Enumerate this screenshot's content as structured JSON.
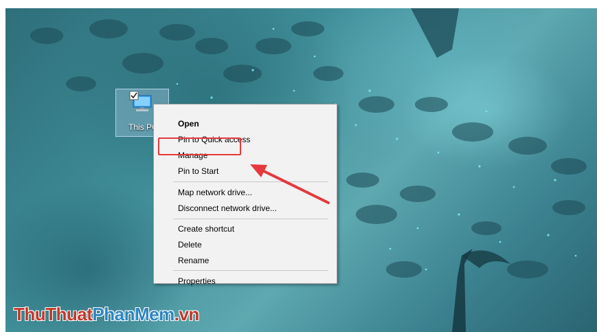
{
  "desktop": {
    "icon": {
      "label": "This PC",
      "icon_name": "this-pc-icon"
    }
  },
  "context_menu": {
    "items": [
      {
        "label": "Open",
        "bold": true
      },
      {
        "label": "Pin to Quick access"
      },
      {
        "label": "Manage",
        "highlighted": true
      },
      {
        "label": "Pin to Start"
      },
      {
        "label": "Map network drive..."
      },
      {
        "label": "Disconnect network drive..."
      },
      {
        "label": "Create shortcut"
      },
      {
        "label": "Delete"
      },
      {
        "label": "Rename"
      },
      {
        "label": "Properties"
      }
    ]
  },
  "annotation": {
    "highlight_color": "#e5393b",
    "arrow_color": "#e5393b"
  },
  "watermark": {
    "part1": "ThuThuat",
    "part2": "PhanMem",
    "part3": ".vn"
  }
}
